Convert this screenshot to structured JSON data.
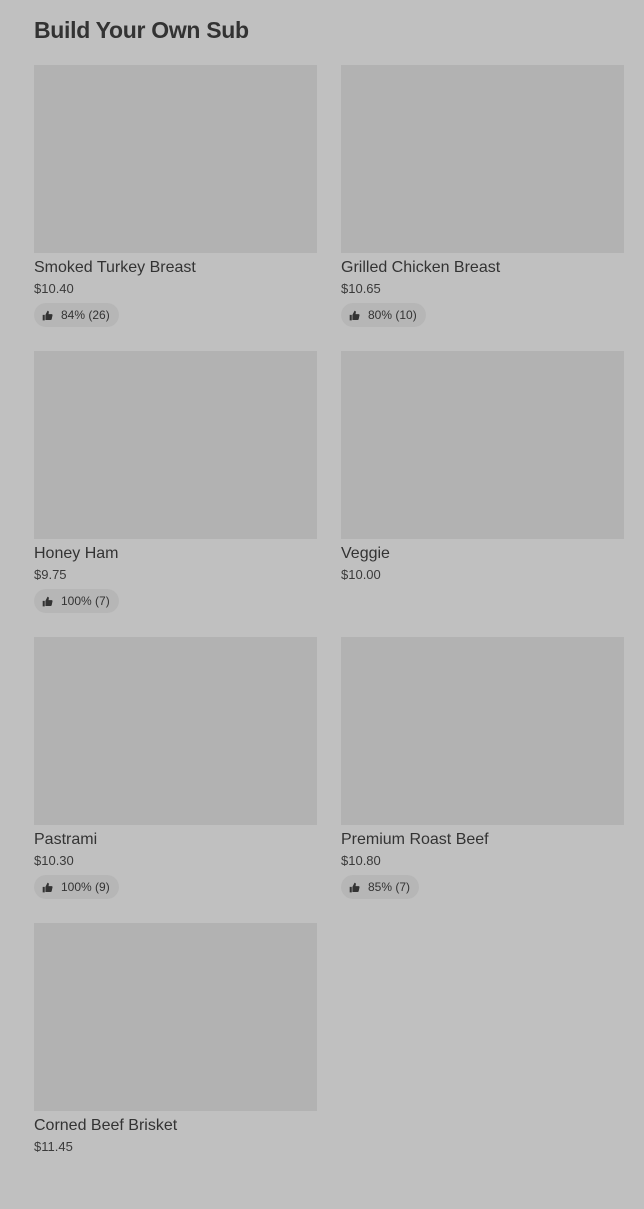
{
  "section": {
    "title": "Build Your Own Sub"
  },
  "items": [
    {
      "name": "Smoked Turkey Breast",
      "price": "$10.40",
      "rating": "84% (26)"
    },
    {
      "name": "Grilled Chicken Breast",
      "price": "$10.65",
      "rating": "80% (10)"
    },
    {
      "name": "Honey Ham",
      "price": "$9.75",
      "rating": "100% (7)"
    },
    {
      "name": "Veggie",
      "price": "$10.00",
      "rating": null
    },
    {
      "name": "Pastrami",
      "price": "$10.30",
      "rating": "100% (9)"
    },
    {
      "name": "Premium Roast Beef",
      "price": "$10.80",
      "rating": "85% (7)"
    },
    {
      "name": "Corned Beef Brisket",
      "price": "$11.45",
      "rating": null
    }
  ],
  "icons": {
    "rating": "thumbs-up-icon"
  },
  "colors": {
    "background": "#c0c0c0",
    "thumbnail": "#b2b2b2",
    "rating_pill": "#b6b6b6",
    "text": "#333333"
  }
}
